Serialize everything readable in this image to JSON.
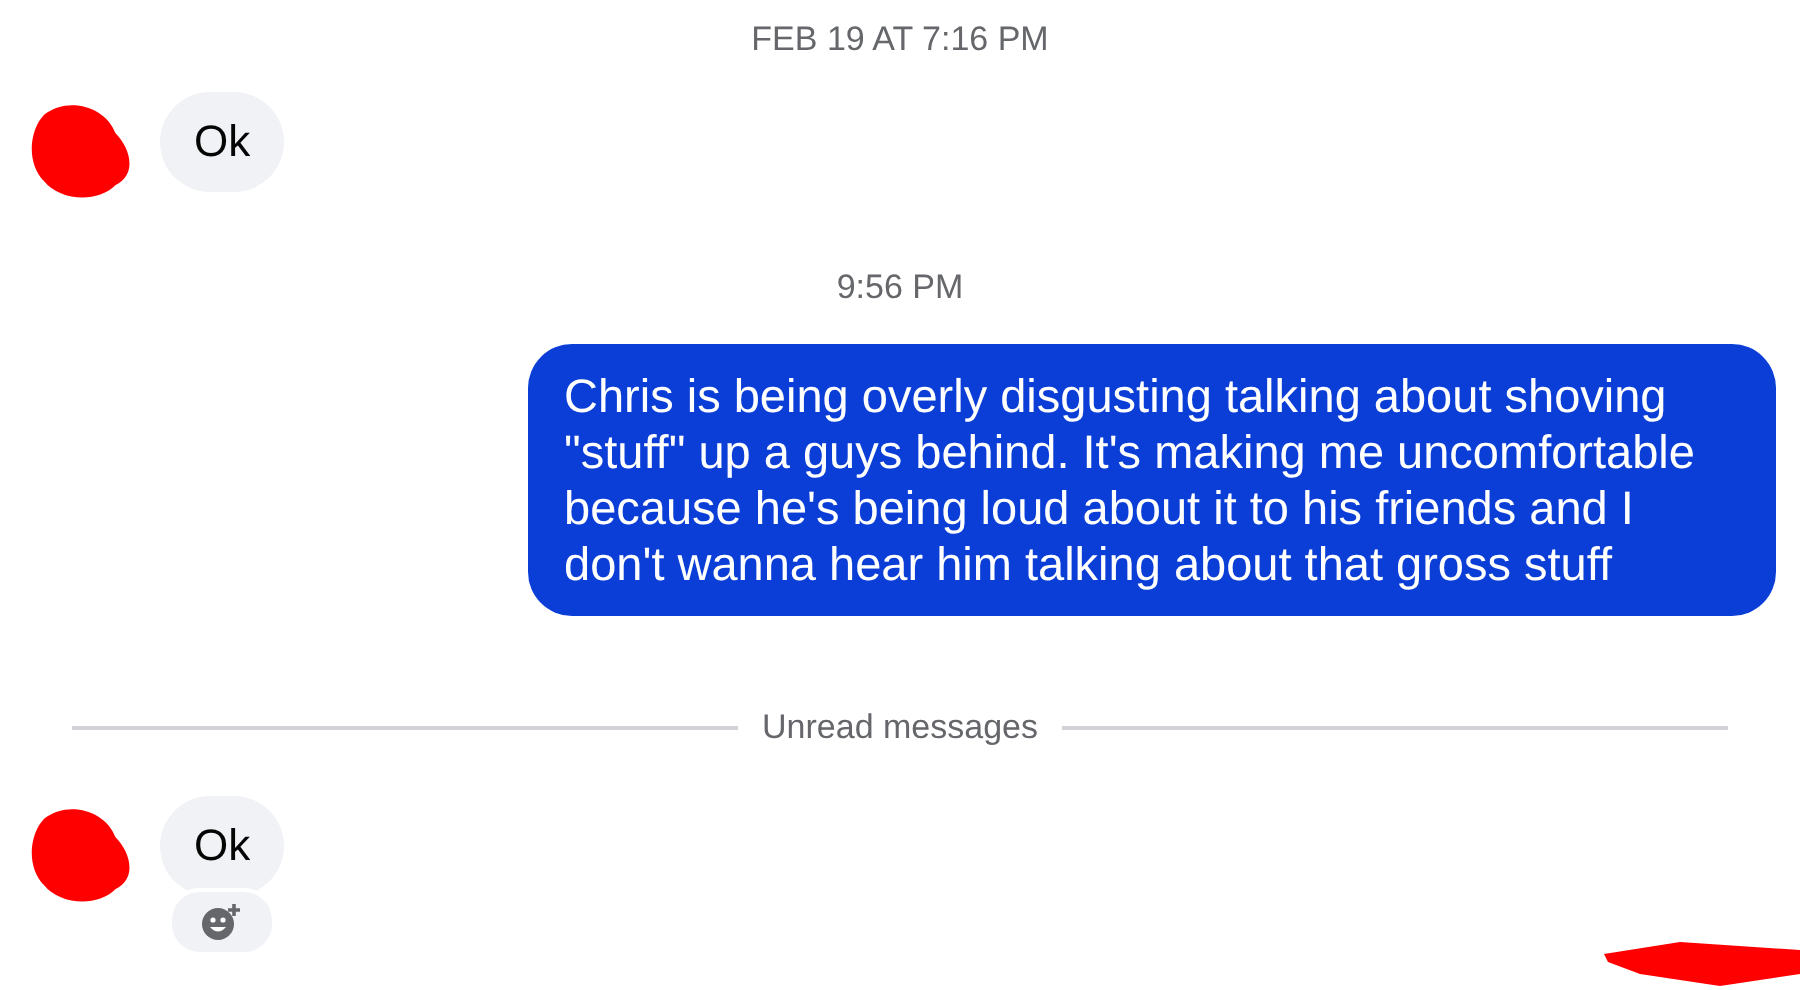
{
  "messages": [
    {
      "kind": "timestamp",
      "text": "FEB 19 AT 7:16 PM"
    },
    {
      "kind": "incoming",
      "text": "Ok",
      "reaction_button": false
    },
    {
      "kind": "timestamp",
      "text": "9:56 PM"
    },
    {
      "kind": "outgoing",
      "text": "Chris is being overly disgusting talking about shoving \"stuff\" up a guys behind. It's making me uncomfortable because he's being loud about it to his friends and I don't wanna hear him talking about that gross stuff"
    },
    {
      "kind": "divider",
      "text": "Unread messages"
    },
    {
      "kind": "incoming",
      "text": "Ok",
      "reaction_button": true
    }
  ]
}
